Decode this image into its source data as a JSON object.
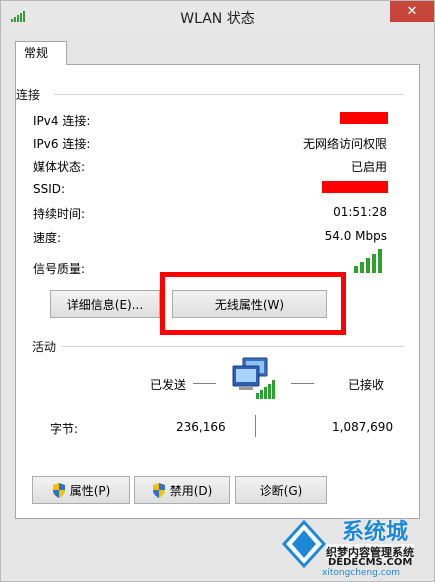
{
  "window": {
    "title": "WLAN 状态",
    "close_glyph": "✕"
  },
  "tab": {
    "label": "常规"
  },
  "connection": {
    "title": "连接",
    "rows": [
      {
        "label": "IPv4 连接:",
        "value": ""
      },
      {
        "label": "IPv6 连接:",
        "value": "无网络访问权限"
      },
      {
        "label": "媒体状态:",
        "value": "已启用"
      },
      {
        "label": "SSID:",
        "value": ""
      },
      {
        "label": "持续时间:",
        "value": "01:51:28"
      },
      {
        "label": "速度:",
        "value": "54.0 Mbps"
      }
    ],
    "signal_label": "信号质量:",
    "signal_bars": 5,
    "details_button": "详细信息(E)...",
    "wireless_button": "无线属性(W)"
  },
  "activity": {
    "title": "活动",
    "sent_label": "已发送",
    "received_label": "已接收",
    "bytes_label": "字节:",
    "bytes_sent": "236,166",
    "bytes_received": "1,087,690"
  },
  "buttons": {
    "properties": "属性(P)",
    "disable": "禁用(D)",
    "diagnose": "诊断(G)"
  },
  "watermark": {
    "brand": "系统城",
    "line1": "织梦内容管理系统",
    "line2": "DEDECMS.COM",
    "line3": "xitongcheng.com"
  },
  "colors": {
    "highlight": "#ff0000",
    "signal": "#2fa02f",
    "close": "#c7463c"
  },
  "icons": [
    "wifi-signal-icon",
    "network-computers-icon",
    "shield-icon"
  ]
}
